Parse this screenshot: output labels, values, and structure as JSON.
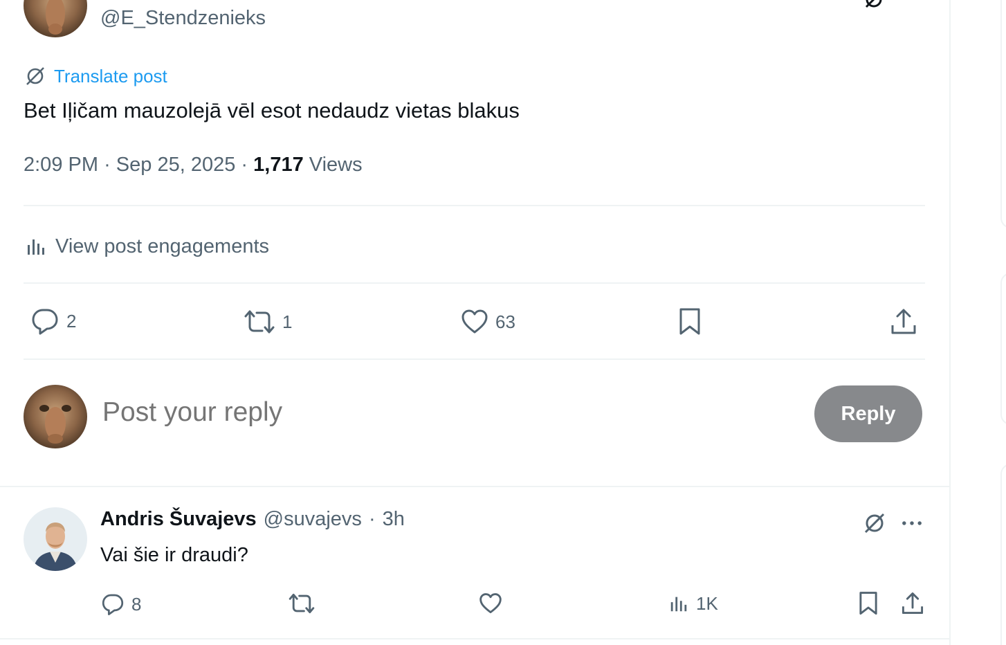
{
  "author": {
    "handle": "@E_Stendzenieks"
  },
  "post": {
    "translate_label": "Translate post",
    "text": "Bet Iļičam mauzolejā vēl esot nedaudz vietas blakus",
    "time": "2:09 PM",
    "separator": "·",
    "date": "Sep 25, 2025",
    "views_count": "1,717",
    "views_label": "Views",
    "engagements_label": "View post engagements",
    "replies": "2",
    "reposts": "1",
    "likes": "63"
  },
  "composer": {
    "placeholder": "Post your reply",
    "reply_button": "Reply"
  },
  "reply": {
    "name": "Andris Šuvajevs",
    "handle": "@suvajevs",
    "separator": "·",
    "time": "3h",
    "text": "Vai šie ir draudi?",
    "replies": "8",
    "views": "1K"
  },
  "icons": {
    "grok": "grok-icon",
    "reply": "reply-icon",
    "repost": "repost-icon",
    "like": "heart-icon",
    "bookmark": "bookmark-icon",
    "share": "share-icon",
    "analytics": "analytics-icon",
    "more": "more-icon"
  },
  "colors": {
    "accent": "#1d9bf0",
    "text": "#0f1419",
    "muted": "#536471",
    "divider": "#eff3f4",
    "reply_button_disabled": "#87898c"
  }
}
